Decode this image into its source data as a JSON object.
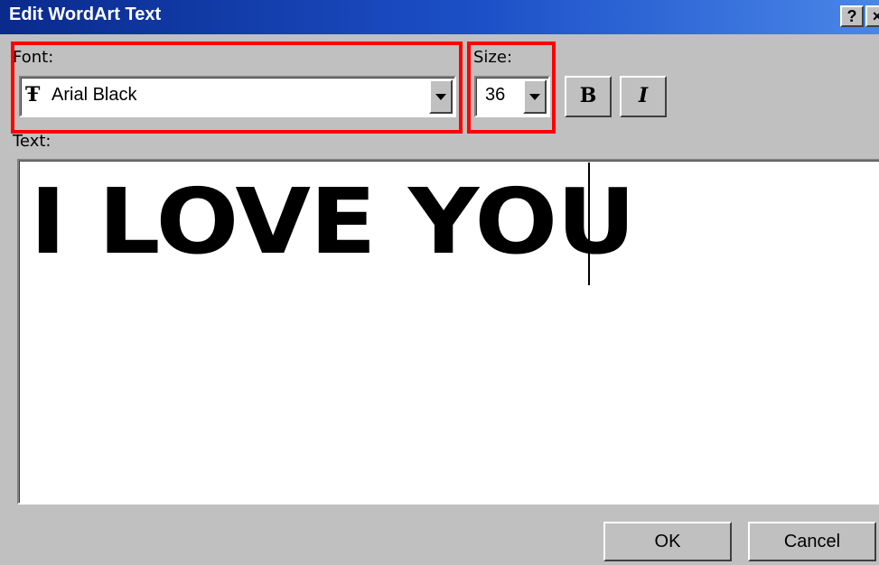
{
  "window": {
    "title": "Edit WordArt Text",
    "help_glyph": "?",
    "close_glyph": "×"
  },
  "font": {
    "label": "Font:",
    "value": "Arial Black",
    "icon": "truetype-font-icon",
    "icon_glyph": "Ŧ"
  },
  "size": {
    "label": "Size:",
    "value": "36"
  },
  "format": {
    "bold_label": "B",
    "italic_label": "I"
  },
  "text": {
    "label": "Text:",
    "content": "I LOVE YOU"
  },
  "buttons": {
    "ok_label": "OK",
    "cancel_label": "Cancel"
  },
  "colors": {
    "highlight": "#ff0000",
    "titlebar_start": "#0a2a8c",
    "titlebar_end": "#4a86e8"
  }
}
